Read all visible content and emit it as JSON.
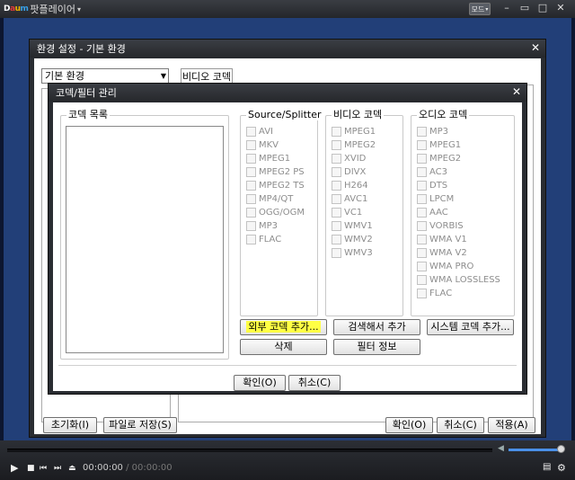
{
  "app": {
    "title": "팟플레이어",
    "mode_label": "모드"
  },
  "playback": {
    "current_time": "00:00:00",
    "separator": "/",
    "duration": "00:00:00"
  },
  "settings": {
    "title": "환경 설정 - 기본 환경",
    "category_selected": "기본 환경",
    "tab_label": "비디오 코덱",
    "buttons": {
      "reset": "초기화(I)",
      "save_file": "파일로 저장(S)",
      "ok": "확인(O)",
      "cancel": "취소(C)",
      "apply": "적용(A)"
    }
  },
  "codec": {
    "title": "코덱/필터 관리",
    "codec_list_title": "코덱 목록",
    "groups": [
      {
        "title": "Source/Splitter",
        "items": [
          "AVI",
          "MKV",
          "MPEG1",
          "MPEG2 PS",
          "MPEG2 TS",
          "MP4/QT",
          "OGG/OGM",
          "MP3",
          "FLAC"
        ]
      },
      {
        "title": "비디오 코덱",
        "items": [
          "MPEG1",
          "MPEG2",
          "XVID",
          "DIVX",
          "H264",
          "AVC1",
          "VC1",
          "WMV1",
          "WMV2",
          "WMV3"
        ]
      },
      {
        "title": "오디오 코덱",
        "items": [
          "MP3",
          "MPEG1",
          "MPEG2",
          "AC3",
          "DTS",
          "LPCM",
          "AAC",
          "VORBIS",
          "WMA V1",
          "WMA V2",
          "WMA PRO",
          "WMA LOSSLESS",
          "FLAC"
        ]
      }
    ],
    "buttons": {
      "add_external": "외부 코덱 추가...",
      "search_add": "검색해서 추가",
      "add_system": "시스템 코덱 추가...",
      "delete": "삭제",
      "filter_info": "필터 정보",
      "ok": "확인(O)",
      "cancel": "취소(C)"
    }
  }
}
